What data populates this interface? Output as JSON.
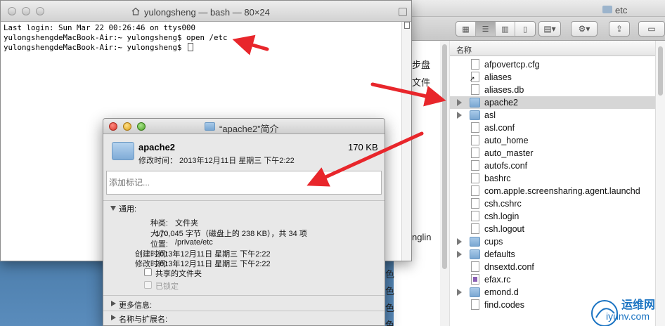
{
  "terminal": {
    "title": "yulongsheng — bash — 80×24",
    "lines": [
      "Last login: Sun Mar 22 00:26:46 on ttys000",
      "yulongshengdeMacBook-Air:~ yulongsheng$ open /etc",
      "yulongshengdeMacBook-Air:~ yulongsheng$ "
    ],
    "peek_texts": [
      "步盘",
      "文件",
      "nglin",
      "色",
      "色",
      "色",
      "色"
    ]
  },
  "finder": {
    "title": "etc",
    "column_header": "名称",
    "items": [
      {
        "name": "afpovertcp.cfg",
        "kind": "doc",
        "expandable": false,
        "selected": false
      },
      {
        "name": "aliases",
        "kind": "alias",
        "expandable": false,
        "selected": false
      },
      {
        "name": "aliases.db",
        "kind": "doc",
        "expandable": false,
        "selected": false
      },
      {
        "name": "apache2",
        "kind": "folder",
        "expandable": true,
        "selected": true
      },
      {
        "name": "asl",
        "kind": "folder",
        "expandable": true,
        "selected": false
      },
      {
        "name": "asl.conf",
        "kind": "doc",
        "expandable": false,
        "selected": false
      },
      {
        "name": "auto_home",
        "kind": "doc",
        "expandable": false,
        "selected": false
      },
      {
        "name": "auto_master",
        "kind": "doc",
        "expandable": false,
        "selected": false
      },
      {
        "name": "autofs.conf",
        "kind": "doc",
        "expandable": false,
        "selected": false
      },
      {
        "name": "bashrc",
        "kind": "doc",
        "expandable": false,
        "selected": false
      },
      {
        "name": "com.apple.screensharing.agent.launchd",
        "kind": "doc",
        "expandable": false,
        "selected": false
      },
      {
        "name": "csh.cshrc",
        "kind": "doc",
        "expandable": false,
        "selected": false
      },
      {
        "name": "csh.login",
        "kind": "doc",
        "expandable": false,
        "selected": false
      },
      {
        "name": "csh.logout",
        "kind": "doc",
        "expandable": false,
        "selected": false
      },
      {
        "name": "cups",
        "kind": "folder",
        "expandable": true,
        "selected": false
      },
      {
        "name": "defaults",
        "kind": "folder",
        "expandable": true,
        "selected": false
      },
      {
        "name": "dnsextd.conf",
        "kind": "doc",
        "expandable": false,
        "selected": false
      },
      {
        "name": "efax.rc",
        "kind": "purple",
        "expandable": false,
        "selected": false
      },
      {
        "name": "emond.d",
        "kind": "folder",
        "expandable": true,
        "selected": false
      },
      {
        "name": "find.codes",
        "kind": "doc",
        "expandable": false,
        "selected": false
      }
    ]
  },
  "info": {
    "title": "“apache2”简介",
    "name": "apache2",
    "size": "170 KB",
    "modified": "修改时间： 2013年12月11日 星期三 下午2:22",
    "tags_placeholder": "添加标记...",
    "general_label": "通用:",
    "fields": [
      {
        "label": "种类:",
        "value": "文件夹"
      },
      {
        "label": "大小:",
        "value": "170,045 字节（磁盘上的 238 KB），共 34 项"
      },
      {
        "label": "位置:",
        "value": "/private/etc"
      },
      {
        "label": "创建时间:",
        "value": "2013年12月11日 星期三 下午2:22"
      },
      {
        "label": "修改时间:",
        "value": "2013年12月11日 星期三 下午2:22"
      }
    ],
    "shared_folder_label": "共享的文件夹",
    "locked_label": "已锁定",
    "more_info_label": "更多信息:",
    "name_ext_label": "名称与扩展名:"
  },
  "watermark": {
    "line1": "运维网",
    "line2": "iyunv.com"
  },
  "colors": {
    "arrow": "#e8262b",
    "selection": "#d6d6d6",
    "watermark": "#1a73c2"
  }
}
